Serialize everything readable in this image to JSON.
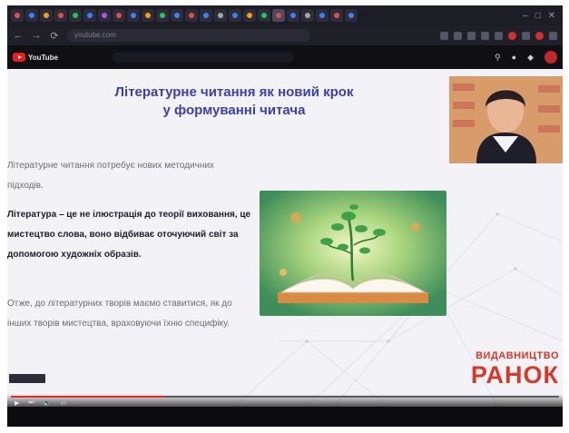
{
  "browser": {
    "tab_dot_colors": [
      "#e34a4a",
      "#3b82f6",
      "#f59e0b",
      "#e34a4a",
      "#22c55e",
      "#3b82f6",
      "#a855f7",
      "#e34a4a",
      "#3b82f6",
      "#f59e0b",
      "#22c55e",
      "#3b82f6",
      "#e34a4a",
      "#3b82f6",
      "#9ca3af",
      "#3b82f6",
      "#f59e0b",
      "#22c55e",
      "#e34a4a",
      "#3b82f6",
      "#9ca3af",
      "#3b82f6",
      "#e34a4a",
      "#3b82f6"
    ],
    "url": "youtube.com"
  },
  "youtube": {
    "logo_text": "YouTube"
  },
  "slide": {
    "title_line1": "Літературне читання як новий крок",
    "title_line2": "у формуванні читача",
    "paragraph1": "Літературне читання потребує нових методичних підходів.",
    "paragraph2": "Література – це не ілюстрація до теорії виховання, це мистецтво слова, воно відбиває оточуючий світ за допомогою художніх образів.",
    "paragraph3": "Отже, до літературних творів маємо ставитися, як до інших творів мистецтва, враховуючи їхню специфіку.",
    "publisher_line1": "ВИДАВНИЦТВО",
    "publisher_line2": "РАНОК",
    "title_color": "#3b3fa6",
    "publisher_color": "#d43a2c"
  }
}
